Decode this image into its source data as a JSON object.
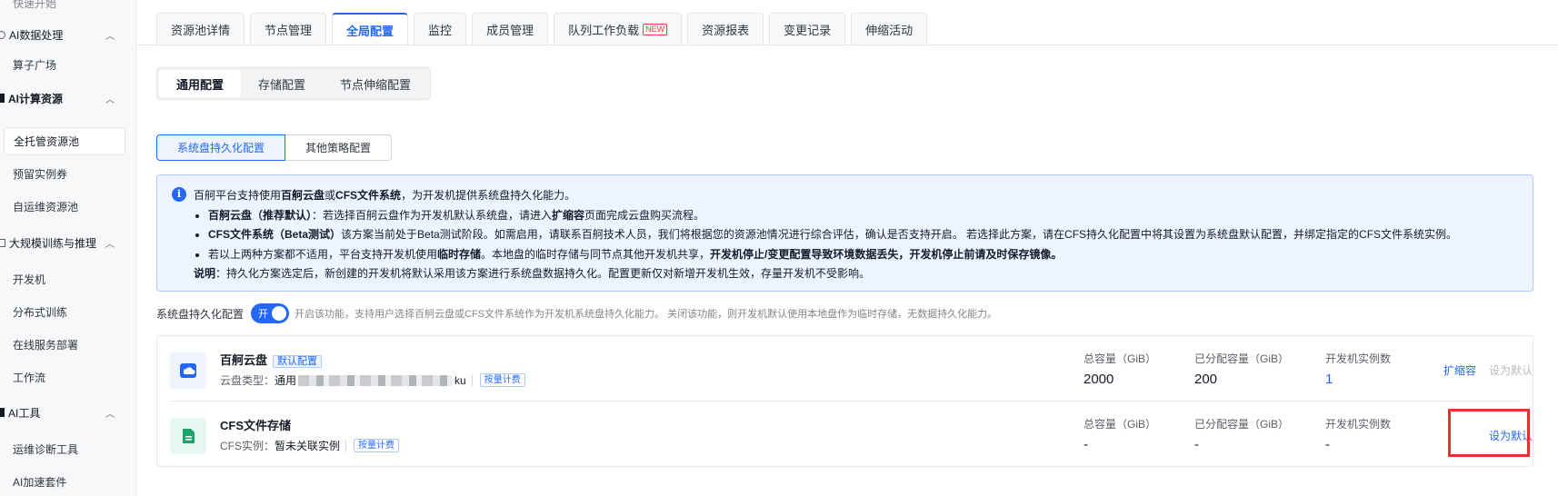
{
  "sidebar": {
    "top_partial": "快速开始",
    "groups": [
      {
        "label": "AI数据处理",
        "items": [
          "算子广场"
        ]
      },
      {
        "label": "AI计算资源",
        "items": [
          "全托管资源池",
          "预留实例券",
          "自运维资源池"
        ]
      },
      {
        "label": "大规模训练与推理",
        "items": [
          "开发机",
          "分布式训练",
          "在线服务部署",
          "工作流"
        ]
      },
      {
        "label": "AI工具",
        "items": [
          "运维诊断工具",
          "AI加速套件"
        ]
      }
    ],
    "active_item": "全托管资源池"
  },
  "tabs": [
    {
      "label": "资源池详情"
    },
    {
      "label": "节点管理"
    },
    {
      "label": "全局配置",
      "active": true
    },
    {
      "label": "监控"
    },
    {
      "label": "成员管理"
    },
    {
      "label": "队列工作负载",
      "badge": "NEW"
    },
    {
      "label": "资源报表"
    },
    {
      "label": "变更记录"
    },
    {
      "label": "伸缩活动"
    }
  ],
  "config_tabs": [
    "通用配置",
    "存储配置",
    "节点伸缩配置"
  ],
  "strategy_tabs": [
    "系统盘持久化配置",
    "其他策略配置"
  ],
  "info": {
    "intro_pre": "百舸平台支持使用",
    "intro_b1": "百舸云盘",
    "intro_mid": "或",
    "intro_b2": "CFS文件系统",
    "intro_post": "，为开发机提供系统盘持久化能力。",
    "b1_title": "百舸云盘（推荐默认）",
    "b1_text_pre": "：若选择百舸云盘作为开发机默认系统盘，请进入",
    "b1_bold": "扩缩容",
    "b1_text_post": "页面完成云盘购买流程。",
    "b2_title": "CFS文件系统（Beta测试）",
    "b2_text": "该方案当前处于Beta测试阶段。如需启用，请联系百舸技术人员，我们将根据您的资源池情况进行综合评估，确认是否支持开启。 若选择此方案，请在CFS持久化配置中将其设置为系统盘默认配置，并绑定指定的CFS文件系统实例。",
    "b3_text_pre": "若以上两种方案都不适用，平台支持开发机使用",
    "b3_bold1": "临时存储",
    "b3_text_mid": "。本地盘的临时存储与同节点其他开发机共享，",
    "b3_bold2": "开发机停止/变更配置导致环境数据丢失，开发机停止前请及时保存镜像。",
    "note_label": "说明",
    "note_text": "：持久化方案选定后，新创建的开发机将默认采用该方案进行系统盘数据持久化。配置更新仅对新增开发机生效，存量开发机不受影响。"
  },
  "toggle": {
    "label": "系统盘持久化配置",
    "state_text": "开",
    "description": "开启该功能，支持用户选择百舸云盘或CFS文件系统作为开发机系统盘持久化能力。 关闭该功能，则开发机默认使用本地盘作为临时存储，无数据持久化能力。"
  },
  "storage_rows": [
    {
      "title": "百舸云盘",
      "tag": "默认配置",
      "sub_label": "云盘类型：",
      "sub_value_visible": "通用",
      "sub_value_suffix": "ku",
      "billing_tag": "按量计费",
      "total_label": "总容量（GiB）",
      "total_value": "2000",
      "allocated_label": "已分配容量（GiB）",
      "allocated_value": "200",
      "instances_label": "开发机实例数",
      "instances_value": "1",
      "action_primary": "扩缩容",
      "action_default": "设为默认"
    },
    {
      "title": "CFS文件存储",
      "sub_label": "CFS实例：",
      "sub_value": "暂未关联实例",
      "billing_tag": "按量计费",
      "total_label": "总容量（GiB）",
      "total_value": "-",
      "allocated_label": "已分配容量（GiB）",
      "allocated_value": "-",
      "instances_label": "开发机实例数",
      "instances_value": "-",
      "action_default": "设为默认"
    }
  ],
  "colors": {
    "accent": "#2468f2",
    "highlight": "#e6312e"
  }
}
